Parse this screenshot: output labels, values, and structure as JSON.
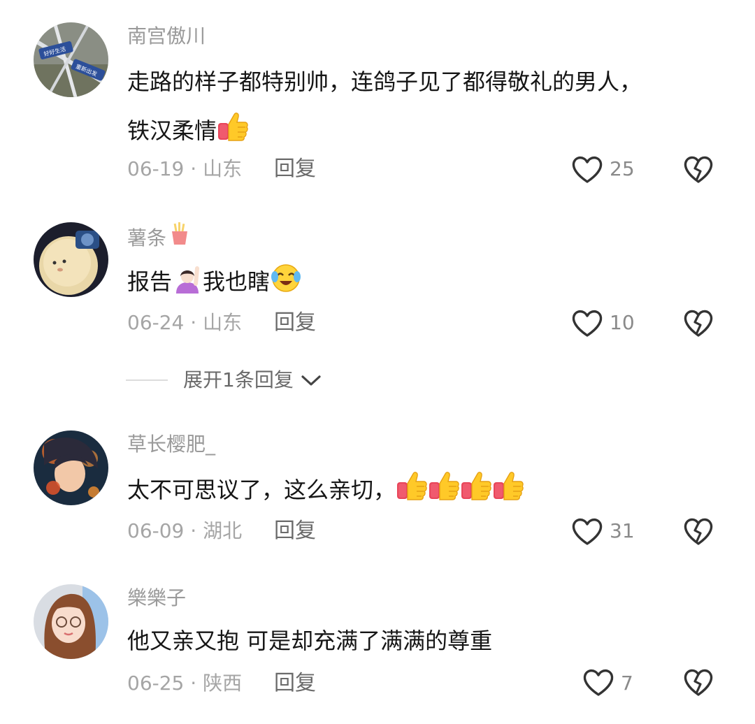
{
  "comments": [
    {
      "username": "南宫傲川",
      "text_line1": "走路的样子都特别帅，连鸽子见了都得敬礼的男人，",
      "text_line2": "铁汉柔情",
      "date": "06-19",
      "location": "山东",
      "reply_label": "回复",
      "likes": "25",
      "avatar_text_1": "好好生活",
      "avatar_text_2": "重新出发"
    },
    {
      "username": "薯条",
      "text_part1": "报告",
      "text_part2": "我也瞎",
      "date": "06-24",
      "location": "山东",
      "reply_label": "回复",
      "likes": "10"
    },
    {
      "username": "草长樱肥_",
      "text": "太不可思议了，这么亲切，",
      "date": "06-09",
      "location": "湖北",
      "reply_label": "回复",
      "likes": "31"
    },
    {
      "username": "樂樂子",
      "text": "他又亲又抱 可是却充满了满满的尊重",
      "date": "06-25",
      "location": "陕西",
      "reply_label": "回复",
      "likes": "7"
    }
  ],
  "expand_replies": {
    "label": "展开1条回复"
  },
  "meta_separator": " · ",
  "icons": {
    "like": "heart-outline-icon",
    "dislike": "broken-heart-icon",
    "thumbs_up": "thumbs-up-emoji",
    "fries": "french-fries-emoji",
    "raising_hand": "person-raising-hand-emoji",
    "laughing_crying": "laughing-crying-emoji",
    "chevron": "chevron-down-icon"
  },
  "colors": {
    "username": "#9a9a9a",
    "text": "#161616",
    "meta": "#a5a5a5",
    "icon": "#333333"
  }
}
